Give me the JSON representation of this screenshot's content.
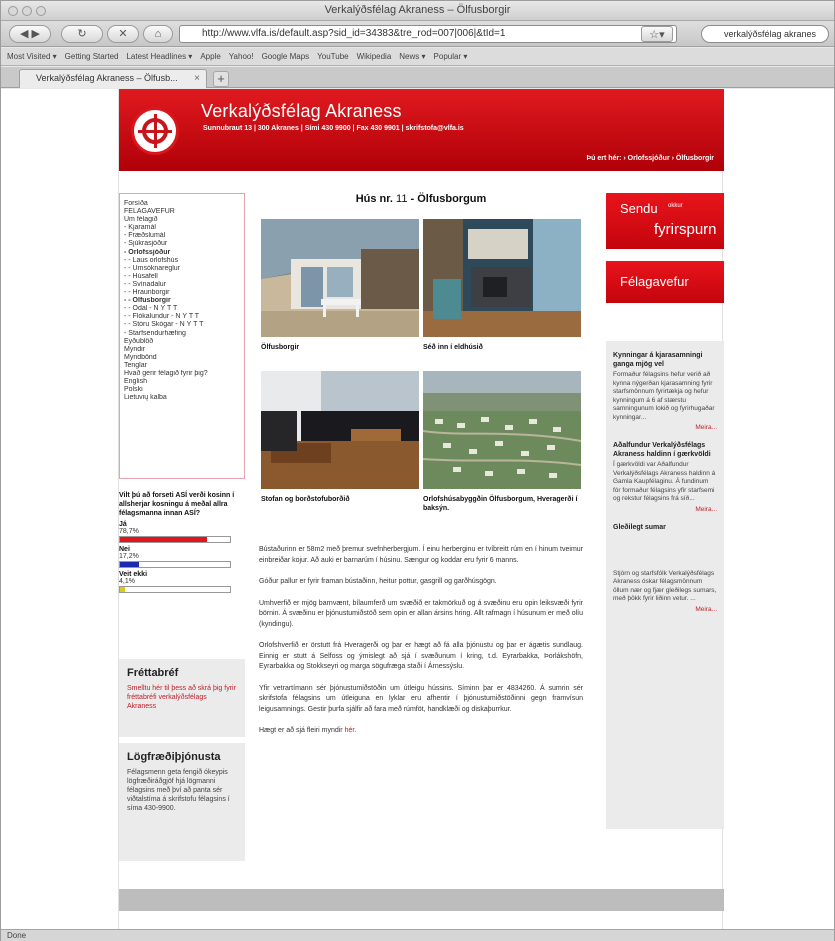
{
  "window": {
    "title": "Verkalýðsfélag Akraness – Ölfusborgir"
  },
  "nav": {
    "url": "http://www.vlfa.is/default.asp?sid_id=34383&tre_rod=007|006|&tId=1",
    "search": "verkalýðsfélag akranes"
  },
  "bookmarks": [
    "Most Visited ▾",
    "Getting Started",
    "Latest Headlines ▾",
    "Apple",
    "Yahoo!",
    "Google Maps",
    "YouTube",
    "Wikipedia",
    "News ▾",
    "Popular ▾"
  ],
  "tab": {
    "label": "Verkalýðsfélag Akraness – Ölfusb..."
  },
  "status": "Done",
  "site": {
    "name": "Verkalýðsfélag Akraness",
    "address": "Sunnubraut 13  |  300 Akranes  |  Sími 430 9900  |  Fax 430 9901  |  skrifstofa@vlfa.is",
    "breadcrumb": "Þú ert hér:  › Orlofssjóður  ›  Ölfusborgir"
  },
  "leftnav": [
    {
      "label": "Forsíða"
    },
    {
      "label": "FÉLAGAVEFUR"
    },
    {
      "label": "Um félagið"
    },
    {
      "label": "- Kjaramál"
    },
    {
      "label": "- Fræðslumál"
    },
    {
      "label": "- Sjúkrasjóður"
    },
    {
      "label": "- Orlofssjóður",
      "active": true
    },
    {
      "label": "- - Laus orlofshús"
    },
    {
      "label": "- - Umsóknareglur"
    },
    {
      "label": "- - Húsafell"
    },
    {
      "label": "- - Svínadalur"
    },
    {
      "label": "- - Hraunborgir"
    },
    {
      "label": "- - Ölfusborgir",
      "active": true
    },
    {
      "label": "- - Ödal - N Ý T T"
    },
    {
      "label": "- - Flókalundur - N Ý T T"
    },
    {
      "label": "- - Stóru Skógar - N Ý T T"
    },
    {
      "label": "- Starfsendurhæfing"
    },
    {
      "label": "Eyðublöð"
    },
    {
      "label": "Myndir"
    },
    {
      "label": "Myndbönd"
    },
    {
      "label": "Tenglar"
    },
    {
      "label": "Hvað gerir félagið fyrir þig?"
    },
    {
      "label": "English"
    },
    {
      "label": "Polski"
    },
    {
      "label": "Lietuvių kalba"
    }
  ],
  "poll": {
    "question": "Vilt þú að forseti ASÍ verði kosinn í allsherjar kosningu á meðal allra félagsmanna innan ASÍ?",
    "options": [
      {
        "label": "Já",
        "pct": "78,7%",
        "value": 0.787,
        "color": "#e0161c"
      },
      {
        "label": "Nei",
        "pct": "17,2%",
        "value": 0.172,
        "color": "#1a2bb0"
      },
      {
        "label": "Veit ekki",
        "pct": "4,1%",
        "value": 0.041,
        "color": "#d6cf17"
      }
    ]
  },
  "newsletter": {
    "title": "Fréttabréf",
    "text": "Smelltu hér til þess að skrá þig fyrir fréttabréfi verkalýðsfélags Akraness"
  },
  "legal": {
    "title": "Lögfræðiþjónusta",
    "text": "Félagsmenn geta fengið ókeypis lögfræðiráðgjöf hjá lögmanni félagsins með því að panta sér viðtalstíma á skrifstofu félagsins í síma 430-9900."
  },
  "main": {
    "title_prefix": "Hús nr.",
    "house_number": "11",
    "title_suffix": "- Ölfusborgum",
    "photos": [
      {
        "caption": "Ölfusborgir"
      },
      {
        "caption": "Séð inn í eldhúsið"
      },
      {
        "caption": "Stofan og borðstofuborðið"
      },
      {
        "caption": "Orlofshúsabyggðin Ölfusborgum, Hveragerði í baksýn."
      }
    ],
    "paragraphs": [
      "Bústaðurinn er 58m2 með þremur svefnherbergjum. Í einu herberginu er tvíbreitt rúm en í hinum tveimur einbreiðar kojur. Að auki er barnarúm í húsinu. Sængur og koddar eru fyrir 6 manns.",
      "Góður pallur er fyrir framan bústaðinn, heitur pottur, gasgrill og garðhúsgögn.",
      "Umhverfið er mjög barnvænt, bílaumferð um svæðið er takmörkuð og á svæðinu eru opin leiksvæði fyrir börnin. Á svæðinu er þjónustumiðstöð sem opin er allan ársins hring. Allt rafmagn í húsunum er með olíu (kyndingu).",
      "Orlofshverfið er örstutt frá Hveragerði og þar er hægt að fá alla þjónustu og þar er ágætis sundlaug. Einnig er stutt á Selfoss og ýmislegt að sjá í svæðunum í kring, t.d. Eyrarbakka, Þorlákshöfn, Eyrarbakka og Stokkseyri og marga sögufræga staði í Árnessýslu.",
      "Yfir vetrartímann sér þjónustumiðstöðin um útleigu hússins. Síminn þar er 4834260. Á sumrin sér skrifstofa félagsins um útleiguna en lyklar eru afhentir í þjónustumiðstöðinni gegn framvísun leigusamnings. Gestir þurfa sjálfir að fara með rúmföt, handklæði og diskaþurrkur."
    ],
    "more_text": "Hægt er að sjá fleiri myndir",
    "more_link": "hér."
  },
  "right": {
    "send_line1": "Sendu",
    "send_small": "okkur",
    "send_line2": "fyrirspurn",
    "members": "Félagavefur",
    "news": [
      {
        "title": "Kynningar á kjarasamningi ganga mjög vel",
        "text": "Formaður félagsins hefur verið að kynna nýgerðan kjarasamning fyrir starfsmönnum fyrirtækja og hefur kynningum á 6 af stærstu samningunum lokið og fyrirhugaðar kynningar...",
        "more": "Meira..."
      },
      {
        "title": "Aðalfundur Verkalýðsfélags Akraness haldinn í gærkvöldi",
        "text": "Í gærkvöldi var Aðalfundur Verkalýðsfélags Akraness haldinn á Gamla Kaupfélaginu. Á fundinum fór formaður félagsins yfir starfsemi og rekstur félagsins frá síð...",
        "more": "Meira..."
      },
      {
        "title": "Gleðilegt sumar",
        "text": "",
        "more": ""
      },
      {
        "title": "",
        "text": "Stjórn og starfsfólk Verkalýðsfélags Akraness óskar félagsmönnum öllum nær og fjær gleðilegs sumars, með þökk fyrir liðinn vetur. ...",
        "more": "Meira..."
      }
    ]
  }
}
